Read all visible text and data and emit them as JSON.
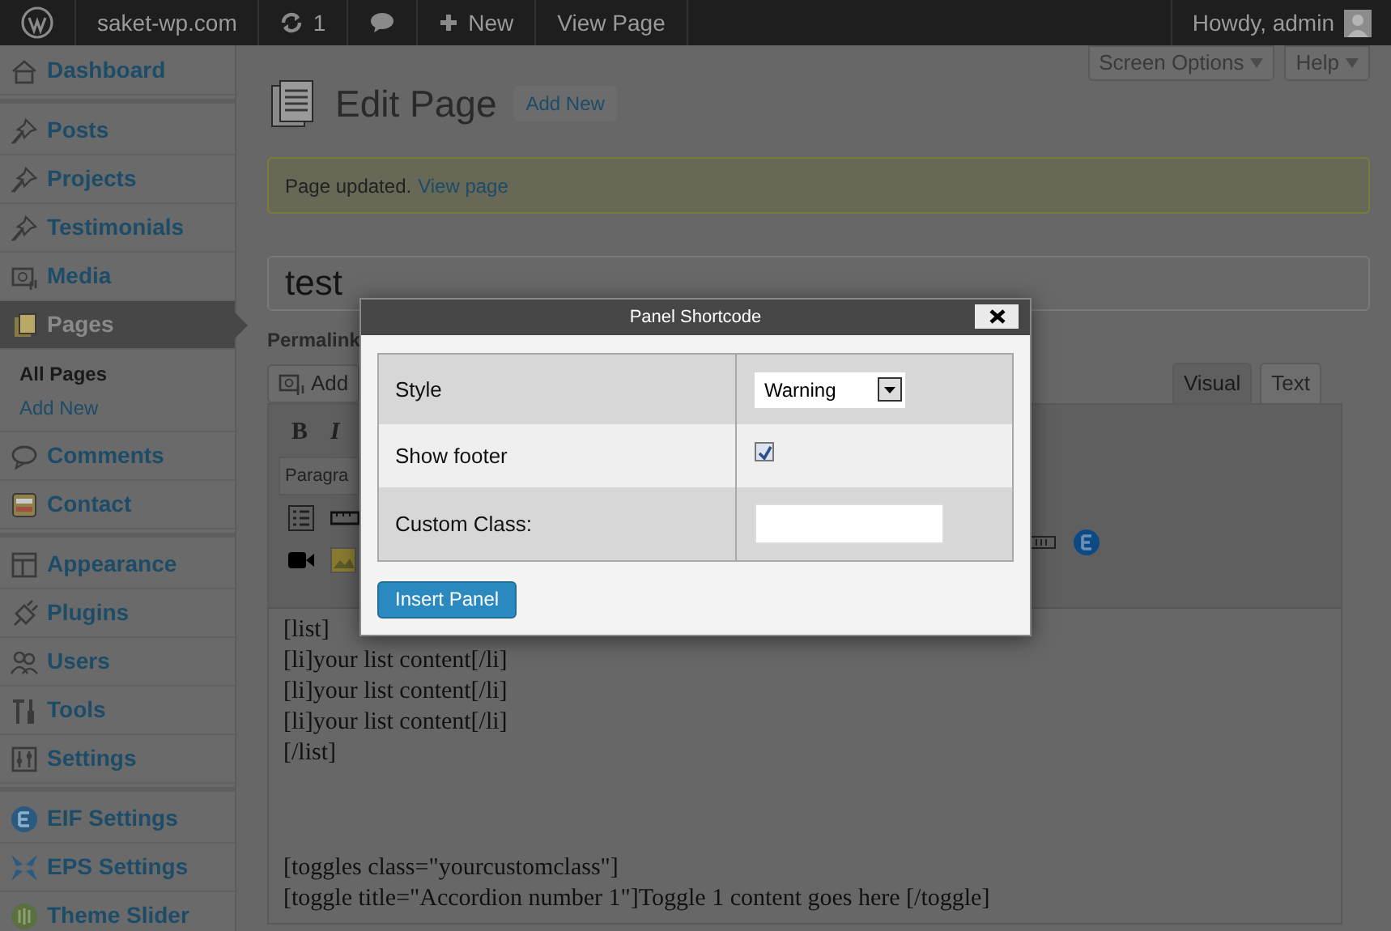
{
  "admin_bar": {
    "items": [
      {
        "kind": "logo"
      },
      {
        "kind": "text",
        "label": "saket-wp.com"
      },
      {
        "kind": "updates",
        "label": "1"
      },
      {
        "kind": "comments"
      },
      {
        "kind": "new",
        "label": "New"
      },
      {
        "kind": "text",
        "label": "View Page"
      }
    ],
    "greeting": "Howdy, admin"
  },
  "sidebar": {
    "groups": [
      [
        {
          "label": "Dashboard",
          "kind": "house",
          "selected": false
        }
      ],
      [
        {
          "label": "Posts",
          "kind": "pin",
          "selected": false
        },
        {
          "label": "Projects",
          "kind": "pin",
          "selected": false
        },
        {
          "label": "Testimonials",
          "kind": "pin",
          "selected": false
        },
        {
          "label": "Media",
          "kind": "media",
          "selected": false
        },
        {
          "label": "Pages",
          "kind": "pages",
          "selected": true,
          "children": [
            {
              "label": "All Pages",
              "selected": true
            },
            {
              "label": "Add New",
              "selected": false
            }
          ]
        },
        {
          "label": "Comments",
          "kind": "comment",
          "selected": false
        },
        {
          "label": "Contact",
          "kind": "contact",
          "selected": false
        }
      ],
      [
        {
          "label": "Appearance",
          "kind": "appearance",
          "selected": false
        },
        {
          "label": "Plugins",
          "kind": "plug",
          "selected": false
        },
        {
          "label": "Users",
          "kind": "users",
          "selected": false
        },
        {
          "label": "Tools",
          "kind": "tools",
          "selected": false
        },
        {
          "label": "Settings",
          "kind": "settings",
          "selected": false
        }
      ],
      [
        {
          "label": "EIF Settings",
          "kind": "eif",
          "selected": false
        },
        {
          "label": "EPS Settings",
          "kind": "eps",
          "selected": false
        },
        {
          "label": "Theme Slider",
          "kind": "slider",
          "selected": false
        }
      ]
    ]
  },
  "header": {
    "screen_options": "Screen Options",
    "help": "Help",
    "title": "Edit Page",
    "add_new": "Add New"
  },
  "notice": {
    "text": "Page updated.",
    "link": "View page"
  },
  "title_field": {
    "value": "test"
  },
  "permalink_label": "Permalink",
  "add_media": "Add",
  "editor": {
    "tabs": [
      {
        "label": "Visual",
        "selected": true
      },
      {
        "label": "Text",
        "selected": false
      }
    ],
    "bold": "B",
    "italic": "I",
    "format": "Paragra",
    "blocks": [
      [
        "[list]",
        "[li]your list content[/li]",
        "[li]your list content[/li]",
        "[li]your list content[/li]",
        "[/list]"
      ],
      [
        "[toggles class=\"yourcustomclass\"]",
        "[toggle title=\"Accordion number 1\"]Toggle 1 content goes here [/toggle]"
      ]
    ]
  },
  "dialog": {
    "title": "Panel Shortcode",
    "rows": [
      {
        "kind": "select",
        "label": "Style",
        "value": "Warning"
      },
      {
        "kind": "checkbox",
        "label": "Show footer",
        "checked": true
      },
      {
        "kind": "text",
        "label": "Custom Class:"
      }
    ],
    "button": "Insert Panel"
  }
}
